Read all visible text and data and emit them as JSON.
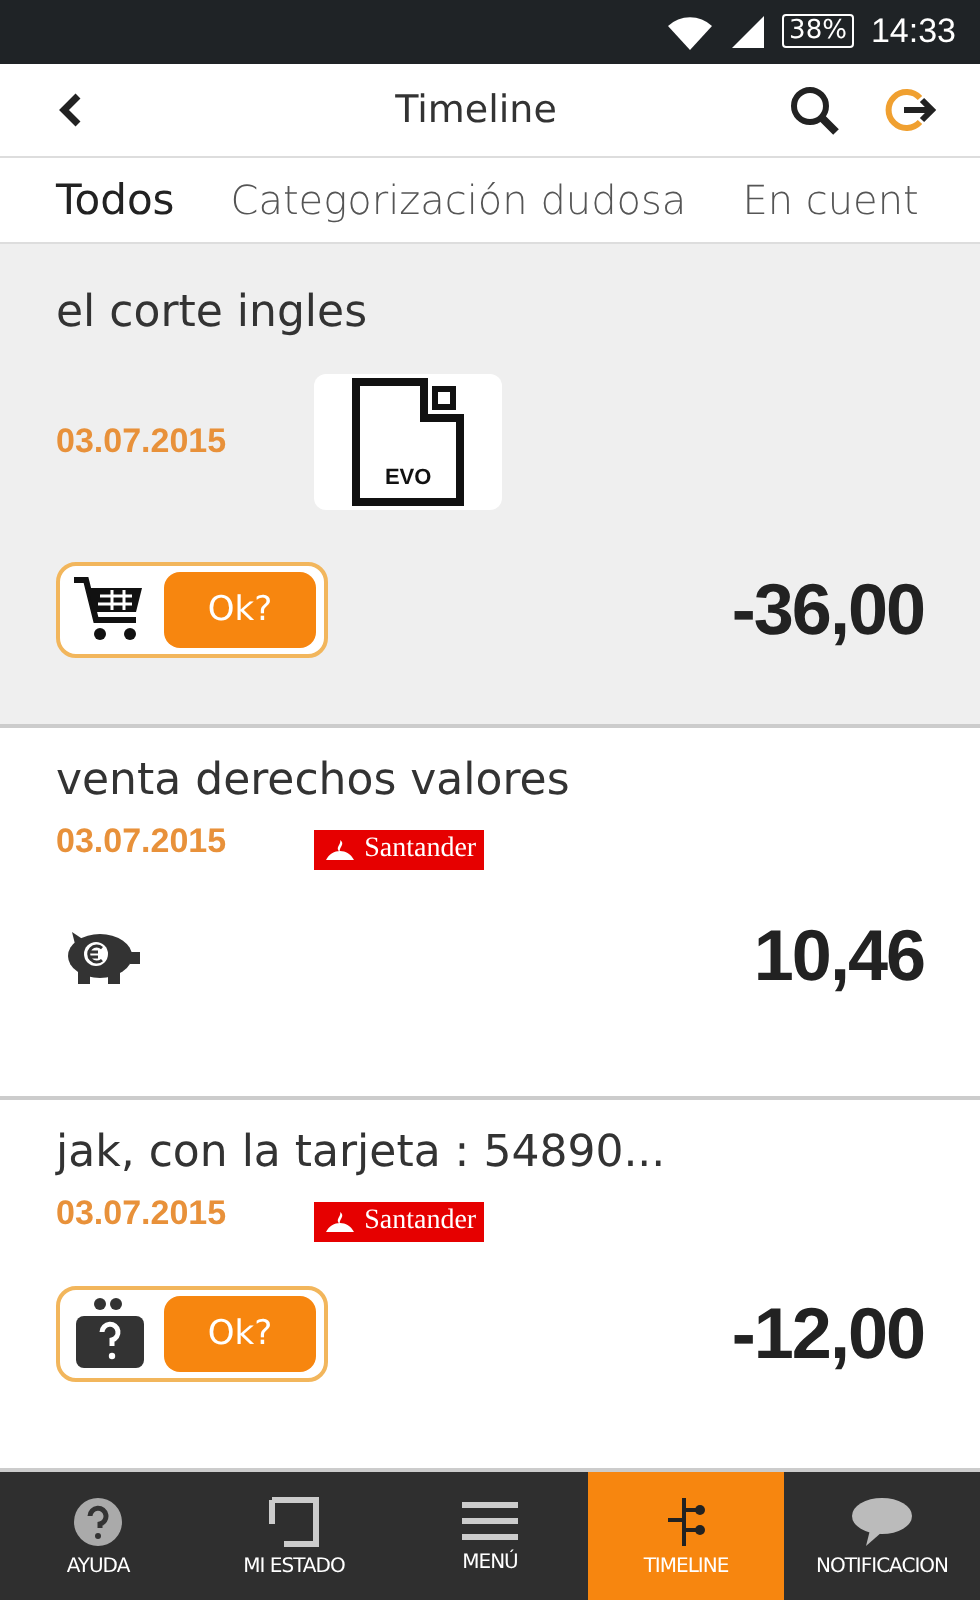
{
  "status_bar": {
    "battery": "38%",
    "time": "14:33"
  },
  "header": {
    "title": "Timeline"
  },
  "tabs": [
    {
      "label": "Todos",
      "selected": true
    },
    {
      "label": "Categorización dudosa",
      "selected": false
    },
    {
      "label": "En cuent",
      "selected": false
    }
  ],
  "transactions": [
    {
      "title": "el corte ingles",
      "date": "03.07.2015",
      "bank": {
        "kind": "evo",
        "name": "EVO"
      },
      "kind": "cart",
      "ok_button": "Ok?",
      "amount": "-36,00",
      "selected": true
    },
    {
      "title": "venta derechos valores",
      "date": "03.07.2015",
      "bank": {
        "kind": "santander",
        "name": "Santander"
      },
      "kind": "piggy",
      "amount": "10,46",
      "selected": false
    },
    {
      "title": "jak, con la tarjeta : 54890...",
      "date": "03.07.2015",
      "bank": {
        "kind": "santander",
        "name": "Santander"
      },
      "kind": "wallet",
      "ok_button": "Ok?",
      "amount": "-12,00",
      "selected": false
    }
  ],
  "bottom_nav": [
    {
      "kind": "help",
      "label": "AYUDA",
      "selected": false
    },
    {
      "kind": "status",
      "label": "MI ESTADO",
      "selected": false
    },
    {
      "kind": "menu",
      "label": "MENÚ",
      "selected": false
    },
    {
      "kind": "timeline",
      "label": "TIMELINE",
      "selected": true
    },
    {
      "kind": "chat",
      "label": "NOTIFICACION",
      "selected": false
    }
  ]
}
